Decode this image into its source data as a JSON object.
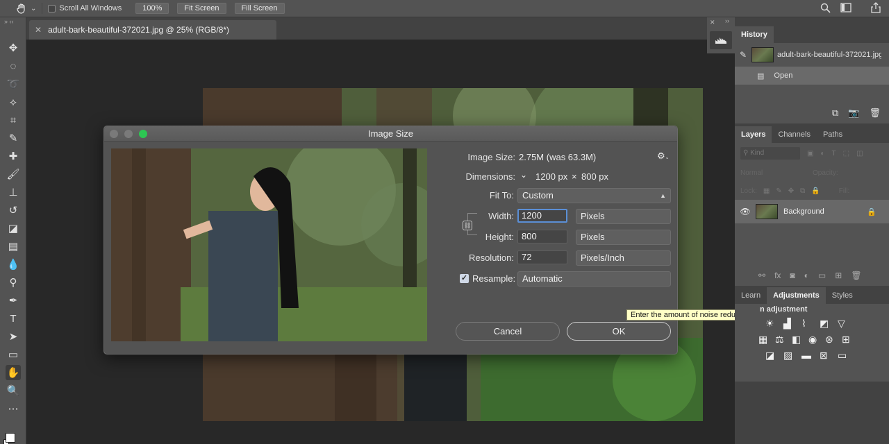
{
  "options_bar": {
    "scroll_all_windows": "Scroll All Windows",
    "zoom_100": "100%",
    "fit_screen": "Fit Screen",
    "fill_screen": "Fill Screen"
  },
  "document": {
    "tab_title": "adult-bark-beautiful-372021.jpg @ 25% (RGB/8*)"
  },
  "dialog": {
    "title": "Image Size",
    "image_size_label": "Image Size:",
    "image_size_value": "2.75M (was 63.3M)",
    "dimensions_label": "Dimensions:",
    "dim_width": "1200 px",
    "dim_times": "×",
    "dim_height": "800 px",
    "fit_to_label": "Fit To:",
    "fit_to_value": "Custom",
    "width_label": "Width:",
    "width_value": "1200",
    "width_unit": "Pixels",
    "height_label": "Height:",
    "height_value": "800",
    "height_unit": "Pixels",
    "resolution_label": "Resolution:",
    "resolution_value": "72",
    "resolution_unit": "Pixels/Inch",
    "resample_label": "Resample:",
    "resample_checked": true,
    "resample_value": "Automatic",
    "cancel_label": "Cancel",
    "ok_label": "OK"
  },
  "tooltip": "Enter the amount of noise reduction",
  "history_panel": {
    "tab": "History",
    "snapshot_name": "adult-bark-beautiful-372021.jpg",
    "steps": [
      "Open"
    ]
  },
  "layers_panel": {
    "tabs": [
      "Layers",
      "Channels",
      "Paths"
    ],
    "active_tab": "Layers",
    "kind_placeholder": "Kind",
    "blend_mode": "Normal",
    "opacity_label": "Opacity:",
    "lock_label": "Lock:",
    "fill_label": "Fill:",
    "layers": [
      {
        "name": "Background",
        "locked": true,
        "visible": true
      }
    ]
  },
  "adjustments_panel": {
    "tabs": [
      "Learn",
      "Adjustments",
      "Styles"
    ],
    "active_tab": "Adjustments",
    "heading": "n adjustment"
  },
  "colors": {
    "ok_green": "#2dc653",
    "focus_blue": "#5b8fd6",
    "tooltip_bg": "#ffffc6"
  }
}
